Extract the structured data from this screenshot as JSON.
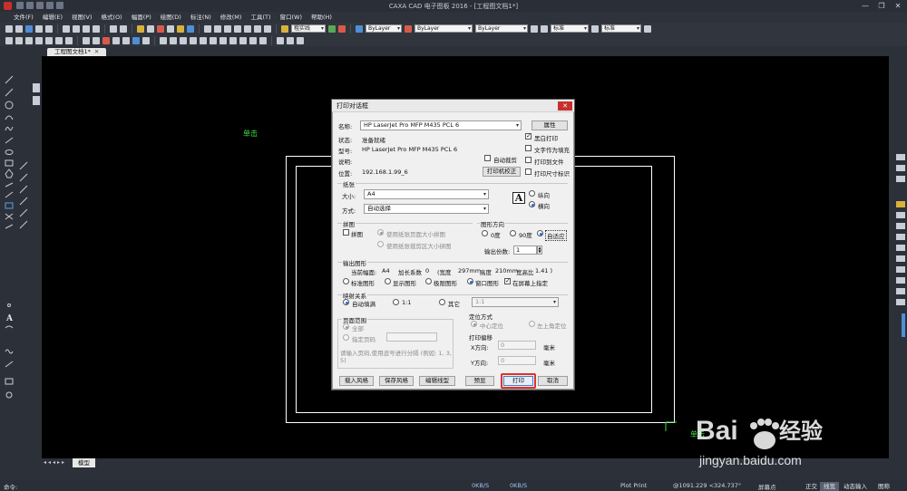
{
  "app": {
    "title": "CAXA CAD 电子图板 2016 - [工程图文档1*]",
    "window_controls": [
      "—",
      "❐",
      "✕"
    ]
  },
  "menu": [
    "文件(F)",
    "编辑(E)",
    "视图(V)",
    "格式(O)",
    "幅面(P)",
    "绘图(D)",
    "标注(N)",
    "修改(M)",
    "工具(T)",
    "窗口(W)",
    "帮助(H)"
  ],
  "toolbar": {
    "line_type_combo": "粗实线",
    "layer_combo_1": "ByLayer",
    "color_combo": "ByLayer",
    "linestyle_combo": "ByLayer",
    "text_style_combo": "标准",
    "dim_style_combo": "标准"
  },
  "document_tab": "工程图文档1*",
  "layout_tab": "模型",
  "canvas": {
    "label_top": "单击",
    "label_bottom": "单击"
  },
  "dialog": {
    "title": "打印对话框",
    "printer": {
      "name_label": "名称:",
      "name_value": "HP LaserJet Pro MFP M435 PCL 6",
      "properties_button": "属性",
      "status_label": "状态:",
      "status_value": "准备就绪",
      "type_label": "型号:",
      "type_value": "HP LaserJet Pro MFP M435 PCL 6",
      "comment_label": "说明:",
      "location_label": "位置:",
      "location_value": "192.168.1.99_6",
      "calibrate_button": "打印机校正",
      "auto_crop": "自动裁剪",
      "black_white": "黑白打印",
      "text_as_fill": "文字作为填充",
      "print_to_file": "打印到文件",
      "print_size_mark": "打印尺寸标识"
    },
    "paper": {
      "group_label": "纸张",
      "size_label": "大小:",
      "size_value": "A4",
      "mode_label": "方式:",
      "mode_value": "自动选择",
      "portrait": "纵向",
      "landscape": "横向",
      "orient_glyph": "A"
    },
    "tiling": {
      "group_label": "拼图",
      "tile_check": "拼图",
      "by_page_size": "使用纸张页面大小拼图",
      "by_crop_size": "使用纸张裁剪区大小拼图"
    },
    "rotation": {
      "group_label": "图形方向",
      "deg0": "0度",
      "deg90": "90度",
      "auto": "自适应",
      "copies_label": "输出份数:",
      "copies_value": "1"
    },
    "output": {
      "group_label": "输出图形",
      "summary_label": "当前幅面:",
      "sheet": "A4",
      "lengthen_label": "加长系数",
      "lengthen_value": "0",
      "width_label": "(宽度",
      "width_value": "297mm",
      "height_label": "高度",
      "height_value": "210mm",
      "ratio_label": "宽高比",
      "ratio_value": "1.41 )",
      "standard": "标准图形",
      "display": "显示图形",
      "extents": "极限图形",
      "window": "窗口图形",
      "on_screen": "在屏幕上指定"
    },
    "mapping": {
      "group_label": "映射关系",
      "auto_fill": "自动填满",
      "one_to_one": "1:1",
      "other": "其它",
      "other_value": "1:1"
    },
    "page_range": {
      "group_label": "页面范围",
      "all": "全部",
      "specified": "指定页码",
      "hint": "请输入页码,使用逗号进行分隔 (例如: 1, 3, 5)"
    },
    "position": {
      "group_label": "定位方式",
      "center": "中心定位",
      "top_left": "左上角定位",
      "offset_label": "打印偏移",
      "x_label": "X方向:",
      "x_value": "0",
      "y_label": "Y方向:",
      "y_value": "0",
      "unit": "毫米"
    },
    "buttons": {
      "load_style": "载入风格",
      "save_style": "保存风格",
      "edit_linetype": "编辑线型",
      "preview": "预显",
      "print": "打印",
      "cancel": "取消"
    }
  },
  "statusbar": {
    "command_label": "命令:",
    "net1": "0KB/S",
    "net2": "0KB/S",
    "mode": "Plot Print",
    "coords": "@1091.229 <324.737°",
    "screen_point": "屏幕点",
    "ortho": "正交",
    "linewidth": "线宽",
    "dynamic_input": "动态输入",
    "ime": "图称"
  },
  "watermark": {
    "brand": "Bai",
    "brand_cn": "经验",
    "url": "jingyan.baidu.com"
  },
  "colors": {
    "canvas": "#000000",
    "cad_green": "#3ce03c",
    "highlight_red": "#e0302c"
  }
}
